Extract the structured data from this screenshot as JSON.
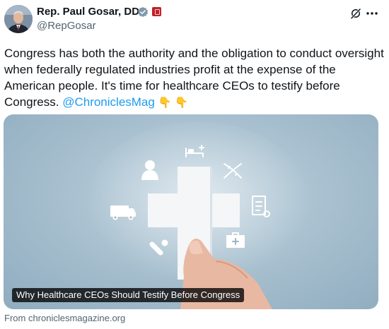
{
  "author": {
    "name": "Rep. Paul Gosar, DDS",
    "handle": "@RepGosar"
  },
  "icons": {
    "verified": "verified-badge-icon",
    "government": "government-label-icon",
    "grok": "grok-icon",
    "more": "more-options-icon"
  },
  "tweet": {
    "text_before": "Congress has both the authority and the obligation to conduct oversight when federally regulated industries profit at the expense of the American people.  It's time for healthcare CEOs to testify before Congress. ",
    "mention": "@ChroniclesMag",
    "emojis": "👇 👇"
  },
  "card": {
    "title": "Why Healthcare CEOs Should Testify Before Congress",
    "source": "From chroniclesmagazine.org"
  },
  "colors": {
    "link": "#1d9bf0",
    "verified": "#829aab",
    "muted": "#536471"
  }
}
